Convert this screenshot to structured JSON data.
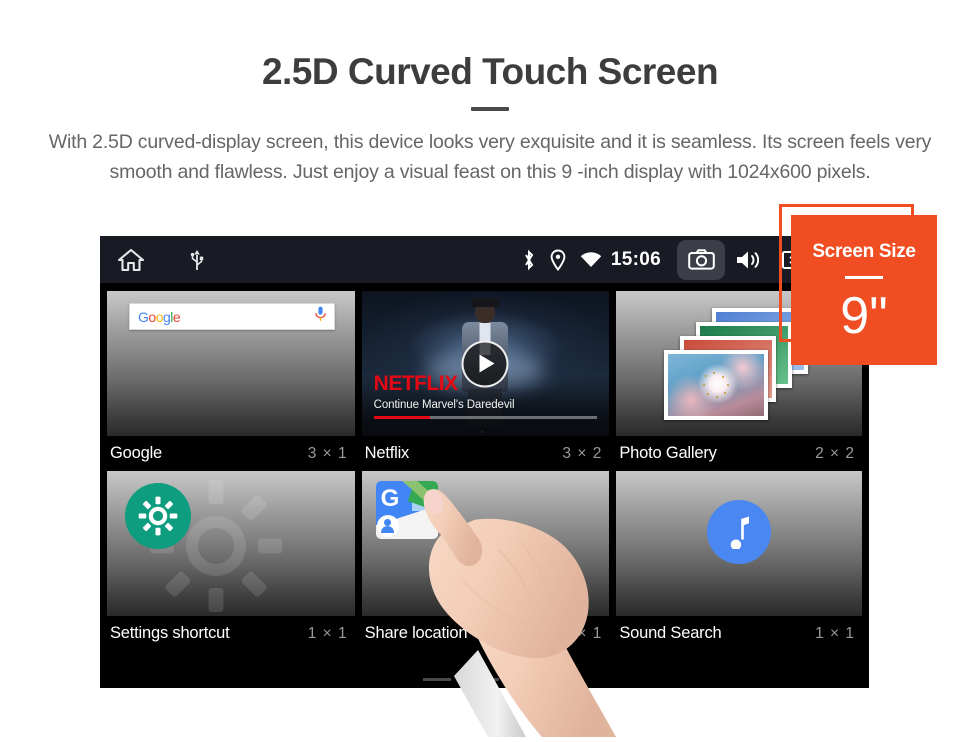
{
  "header": {
    "title": "2.5D Curved Touch Screen",
    "subtitle": "With 2.5D curved-display screen, this device looks very exquisite and it is seamless. Its screen feels very smooth and flawless. Just enjoy a visual feast on this 9 -inch display with 1024x600 pixels."
  },
  "badge": {
    "title": "Screen Size",
    "value": "9\"",
    "color": "#F04D23"
  },
  "device": {
    "statusbar": {
      "clock": "15:06",
      "left_icons": [
        "home-icon",
        "usb-icon"
      ],
      "right_icons": [
        "bluetooth-icon",
        "location-icon",
        "wifi-icon"
      ],
      "action_icons": [
        "camera-icon",
        "volume-icon",
        "close-box-icon",
        "recent-apps-icon"
      ]
    },
    "widgets": [
      {
        "name": "Google",
        "size": "3 × 1",
        "icon": "google-search-widget"
      },
      {
        "name": "Netflix",
        "size": "3 × 2",
        "icon": "netflix-widget"
      },
      {
        "name": "Photo Gallery",
        "size": "2 × 2",
        "icon": "photo-gallery-widget"
      },
      {
        "name": "Settings shortcut",
        "size": "1 × 1",
        "icon": "gear-icon"
      },
      {
        "name": "Share location",
        "size": "1 × 1",
        "icon": "google-maps-icon"
      },
      {
        "name": "Sound Search",
        "size": "1 × 1",
        "icon": "music-note-icon"
      }
    ],
    "netflix": {
      "brand": "NETFLIX",
      "subtitle": "Continue Marvel's Daredevil",
      "progress_percent": 25,
      "brand_color": "#E50914"
    },
    "google": {
      "logo_letters": [
        "G",
        "o",
        "o",
        "g",
        "l",
        "e"
      ],
      "mic_icon": "microphone-icon"
    },
    "page_indicator": {
      "pages": 3,
      "active": 3
    }
  }
}
